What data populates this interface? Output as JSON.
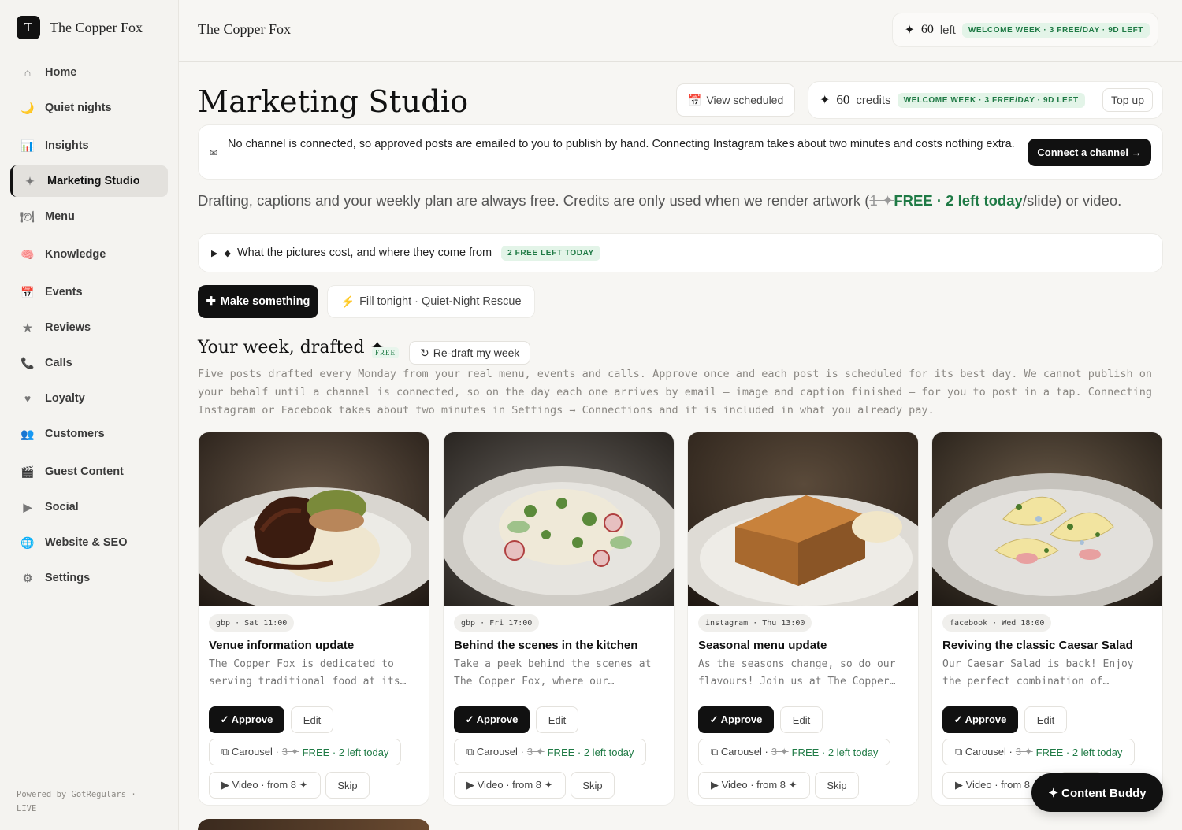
{
  "brand": {
    "logo_letter": "T",
    "name": "The Copper Fox"
  },
  "sidebar": {
    "items": [
      {
        "label": "Home",
        "icon": "home-icon",
        "glyph": "⌂"
      },
      {
        "label": "Quiet nights",
        "icon": "moon-icon",
        "glyph": "🌙"
      },
      {
        "label": "Insights",
        "icon": "chart-icon",
        "glyph": "📊"
      },
      {
        "label": "Marketing Studio",
        "icon": "sparkle-icon",
        "glyph": "✦"
      },
      {
        "label": "Menu",
        "icon": "menu-icon",
        "glyph": "🍽"
      },
      {
        "label": "Knowledge",
        "icon": "brain-icon",
        "glyph": "🧠"
      },
      {
        "label": "Events",
        "icon": "calendar-icon",
        "glyph": "📅"
      },
      {
        "label": "Reviews",
        "icon": "star-icon",
        "glyph": "★"
      },
      {
        "label": "Calls",
        "icon": "phone-icon",
        "glyph": "📞"
      },
      {
        "label": "Loyalty",
        "icon": "heart-icon",
        "glyph": "♥"
      },
      {
        "label": "Customers",
        "icon": "people-icon",
        "glyph": "👥"
      },
      {
        "label": "Guest Content",
        "icon": "clapper-icon",
        "glyph": "🎬"
      },
      {
        "label": "Social",
        "icon": "play-icon",
        "glyph": "▶"
      },
      {
        "label": "Website & SEO",
        "icon": "globe-icon",
        "glyph": "🌐"
      },
      {
        "label": "Settings",
        "icon": "gear-icon",
        "glyph": "⚙"
      }
    ],
    "active_index": 3,
    "powered_by": "Powered by GotRegulars · LIVE"
  },
  "topbar": {
    "title": "The Copper Fox",
    "credits_num": "60",
    "credits_label": "left",
    "badge": "WELCOME WEEK · 3 FREE/DAY · 9D LEFT"
  },
  "header": {
    "title": "Marketing Studio",
    "view_scheduled": "View scheduled",
    "credits_num": "60",
    "credits_label": "credits",
    "badge": "WELCOME WEEK · 3 FREE/DAY · 9D LEFT",
    "top_up": "Top up"
  },
  "notice": {
    "text": "No channel is connected, so approved posts are emailed to you to publish by hand. Connecting Instagram takes about two minutes and costs nothing extra.",
    "button": "Connect a channel →"
  },
  "free_line": {
    "before": "Drafting, captions and your weekly plan are always free. Credits are only used when we render artwork (",
    "strike": "1 ✦",
    "free": "FREE · 2 left today",
    "after": "/slide) or video."
  },
  "details": {
    "label": "What the pictures cost, and where they come from",
    "badge": "2 FREE LEFT TODAY"
  },
  "actions": {
    "make": "Make something",
    "fill": "Fill tonight · Quiet-Night Rescue"
  },
  "week": {
    "title": "Your week, drafted ✦",
    "tag": "FREE",
    "redraft": "Re-draft my week",
    "desc": "Five posts drafted every Monday from your real menu, events and calls. Approve once and each post is scheduled for its best day. We cannot publish on your behalf until a channel is connected, so on the day each one arrives by email — image and caption finished — for you to post in a tap. Connecting Instagram or Facebook takes about two minutes in Settings → Connections and it is included in what you already pay."
  },
  "cards": [
    {
      "chip": "gbp · Sat 11:00",
      "title": "Venue information update",
      "body": "The Copper Fox is dedicated to serving traditional food at its finest, with every plate made fresh.",
      "image": "braised-beef-dish"
    },
    {
      "chip": "gbp · Fri 17:00",
      "title": "Behind the scenes in the kitchen",
      "body": "Take a peek behind the scenes at The Copper Fox, where our talented team prepares every dish.",
      "image": "crab-salad-dish"
    },
    {
      "chip": "instagram · Thu 13:00",
      "title": "Seasonal menu update",
      "body": "As the seasons change, so do our flavours! Join us at The Copper Fox for something new.",
      "image": "sticky-toffee-pudding"
    },
    {
      "chip": "facebook · Wed 18:00",
      "title": "Reviving the classic Caesar Salad",
      "body": "Our Caesar Salad is back! Enjoy the perfect combination of Belgian endive and crisp apple.",
      "image": "endive-salad-dish"
    }
  ],
  "card_actions": {
    "approve": "✓ Approve",
    "edit": "Edit",
    "carousel_label": "⧉ Carousel ·",
    "carousel_strike": "3 ✦",
    "carousel_free": "FREE · 2 left today",
    "video": "▶ Video · from 8 ✦",
    "skip": "Skip"
  },
  "buddy": "✦ Content Buddy"
}
